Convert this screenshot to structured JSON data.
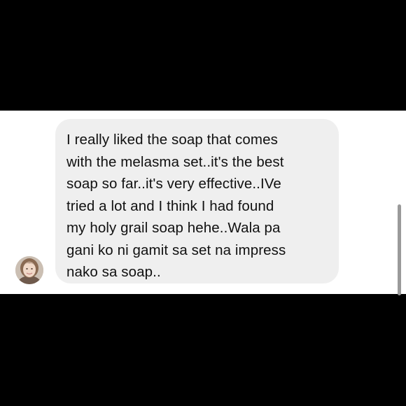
{
  "conversation": {
    "message": {
      "text": "I really liked the soap that comes\nwith the melasma set..it's the best\nsoap so far..it's very effective..IVe\ntried a lot and I think I had found\nmy holy grail soap hehe..Wala pa\ngani ko ni gamit sa set na impress\nnako sa soap.."
    },
    "sender_avatar_icon": "user-avatar-icon"
  },
  "colors": {
    "background": "#000000",
    "chat_background": "#ffffff",
    "bubble": "#efefef",
    "text": "#111111",
    "scrollbar": "#9a9a9a"
  }
}
